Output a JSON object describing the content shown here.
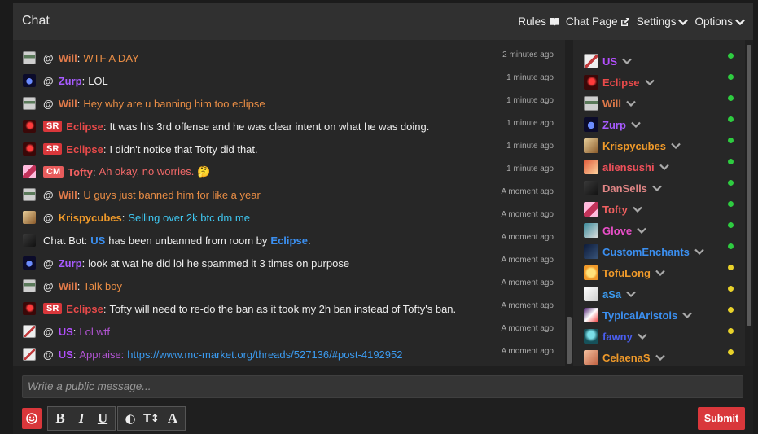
{
  "header": {
    "title": "Chat",
    "rules_label": "Rules",
    "chat_page_label": "Chat Page",
    "settings_label": "Settings",
    "options_label": "Options"
  },
  "messages": [
    {
      "user": "Will",
      "text": "WTF A DAY",
      "time": "2 minutes ago",
      "badge": "",
      "name_color": "#e07a4a",
      "text_color": "#e98d45",
      "avatar": "flag",
      "mention": true
    },
    {
      "user": "Zurp",
      "text": "LOL",
      "time": "1 minute ago",
      "badge": "",
      "name_color": "#a75bff",
      "text_color": "#eeeeee",
      "avatar": "blue",
      "mention": true
    },
    {
      "user": "Will",
      "text": "Hey why are u banning him too eclipse",
      "time": "1 minute ago",
      "badge": "",
      "name_color": "#e07a4a",
      "text_color": "#e98d45",
      "avatar": "flag",
      "mention": true
    },
    {
      "user": "Eclipse",
      "text": "It was his 3rd offense and he was clear intent on what he was doing.",
      "time": "1 minute ago",
      "badge": "SR",
      "badge_color": "#d9373b",
      "name_color": "#e84a4a",
      "text_color": "#eeeeee",
      "avatar": "red",
      "mention": false
    },
    {
      "user": "Eclipse",
      "text": "I didn't notice that Tofty did that.",
      "time": "1 minute ago",
      "badge": "SR",
      "badge_color": "#d9373b",
      "name_color": "#e84a4a",
      "text_color": "#eeeeee",
      "avatar": "red",
      "mention": false
    },
    {
      "user": "Tofty",
      "text": "Ah okay, no worries. 🤔",
      "time": "1 minute ago",
      "badge": "CM",
      "badge_color": "#e85c5c",
      "name_color": "#f06060",
      "text_color": "#f06868",
      "avatar": "pink",
      "mention": false
    },
    {
      "user": "Will",
      "text": "U guys just banned him for like a year",
      "time": "A moment ago",
      "badge": "",
      "name_color": "#e07a4a",
      "text_color": "#e98d45",
      "avatar": "flag",
      "mention": true
    },
    {
      "user": "Krispycubes",
      "text": "Selling over 2k btc dm me",
      "time": "A moment ago",
      "badge": "",
      "name_color": "#f09a2a",
      "text_color": "#3fc8f2",
      "avatar": "tan",
      "mention": true
    },
    {
      "user": "Chat Bot",
      "text": "",
      "time": "A moment ago",
      "badge": "",
      "name_color": "#eeeeee",
      "text_color": "#eeeeee",
      "avatar": "dark",
      "mention": false,
      "bot": true
    },
    {
      "user": "Zurp",
      "text": "look at wat he did lol he spammed it 3 times on purpose",
      "time": "A moment ago",
      "badge": "",
      "name_color": "#a75bff",
      "text_color": "#eeeeee",
      "avatar": "blue",
      "mention": true
    },
    {
      "user": "Will",
      "text": "Talk boy",
      "time": "A moment ago",
      "badge": "",
      "name_color": "#e07a4a",
      "text_color": "#e98d45",
      "avatar": "flag",
      "mention": true
    },
    {
      "user": "Eclipse",
      "text": "Tofty will need to re-do the ban as it took my 2h ban instead of Tofty's ban.",
      "time": "A moment ago",
      "badge": "SR",
      "badge_color": "#d9373b",
      "name_color": "#e84a4a",
      "text_color": "#eeeeee",
      "avatar": "red",
      "mention": false
    },
    {
      "user": "US",
      "text": "Lol wtf",
      "time": "A moment ago",
      "badge": "",
      "name_color": "#b44fff",
      "text_color": "#b455d6",
      "avatar": "flag2",
      "mention": true
    },
    {
      "user": "US",
      "text": "Appraise: https://www.mc-market.org/threads/527136/#post-4192952",
      "time": "A moment ago",
      "badge": "",
      "name_color": "#b44fff",
      "text_color": "#b455d6",
      "avatar": "flag2",
      "mention": true,
      "link": "https://www.mc-market.org/threads/527136/#post-4192952"
    }
  ],
  "bot_message": {
    "prefix": "Chat Bot:",
    "user1": "US",
    "middle": "has been unbanned from room by",
    "user2": "Eclipse",
    "suffix": "."
  },
  "appraise_prefix": "Appraise:",
  "users": [
    {
      "name": "US",
      "color": "#b44fff",
      "status": "#2ecc40",
      "avatar": "flag2"
    },
    {
      "name": "Eclipse",
      "color": "#e84a4a",
      "status": "#2ecc40",
      "avatar": "red"
    },
    {
      "name": "Will",
      "color": "#e07a4a",
      "status": "#2ecc40",
      "avatar": "flag"
    },
    {
      "name": "Zurp",
      "color": "#a75bff",
      "status": "#2ecc40",
      "avatar": "blue"
    },
    {
      "name": "Krispycubes",
      "color": "#f09a2a",
      "status": "#2ecc40",
      "avatar": "tan"
    },
    {
      "name": "aliensushi",
      "color": "#f0505a",
      "status": "#2ecc40",
      "avatar": "orange"
    },
    {
      "name": "DanSells",
      "color": "#e08585",
      "status": "#2ecc40",
      "avatar": "dark"
    },
    {
      "name": "Tofty",
      "color": "#f06060",
      "status": "#2ecc40",
      "avatar": "pink"
    },
    {
      "name": "Glove",
      "color": "#e94fc8",
      "status": "#2ecc40",
      "avatar": "teal"
    },
    {
      "name": "CustomEnchants",
      "color": "#3b8ff0",
      "status": "#2ecc40",
      "avatar": "navy"
    },
    {
      "name": "TofuLong",
      "color": "#f09a2a",
      "status": "#e8d22a",
      "avatar": "yellow"
    },
    {
      "name": "aSa",
      "color": "#3b9bf0",
      "status": "#e8d22a",
      "avatar": "white"
    },
    {
      "name": "TypicalAristois",
      "color": "#3b8ff0",
      "status": "#e8d22a",
      "avatar": "purple"
    },
    {
      "name": "fawny",
      "color": "#4a5ef0",
      "status": "#e8d22a",
      "avatar": "cyan"
    },
    {
      "name": "CelaenaS",
      "color": "#f09a2a",
      "status": "#e8d22a",
      "avatar": "peach"
    }
  ],
  "composer": {
    "placeholder": "Write a public message...",
    "bold": "B",
    "italic": "I",
    "underline": "U",
    "color_icon": "◐",
    "size_icon": "T↕",
    "font_icon": "A",
    "submit_label": "Submit"
  }
}
